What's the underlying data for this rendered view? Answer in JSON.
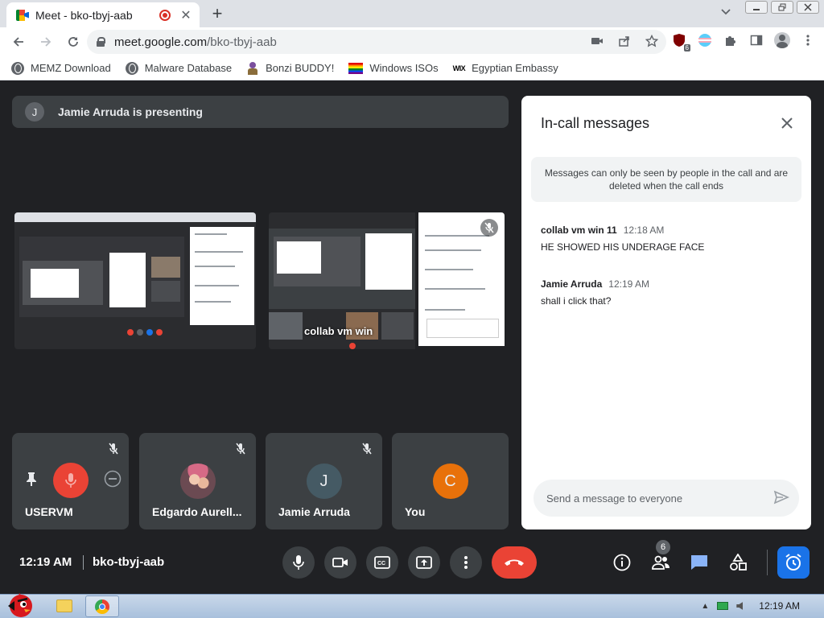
{
  "browser": {
    "tab_title": "Meet - bko-tbyj-aab",
    "tab_close": "✕",
    "new_tab": "+",
    "url_domain": "meet.google.com",
    "url_path": "/bko-tbyj-aab",
    "extension_badge": "6",
    "bookmarks": [
      {
        "label": "MEMZ Download",
        "icon": "globe-icon"
      },
      {
        "label": "Malware Database",
        "icon": "globe-icon"
      },
      {
        "label": "Bonzi BUDDY!",
        "icon": "bonzi-icon"
      },
      {
        "label": "Windows ISOs",
        "icon": "rainbow-flag-icon"
      },
      {
        "label": "Egyptian Embassy",
        "icon": "wix-icon",
        "icon_text": "WIX"
      }
    ]
  },
  "meet": {
    "presenter_initial": "J",
    "presenting_text": "Jamie Arruda is presenting",
    "share_caption": "collab vm win",
    "tiles": [
      {
        "name": "USERVM",
        "muted": true,
        "avatar": "hover-controls"
      },
      {
        "name": "Edgardo Aurell...",
        "muted": true,
        "avatar": "photo"
      },
      {
        "name": "Jamie Arruda",
        "muted": true,
        "avatar": "J",
        "avatar_color": "#455a64"
      },
      {
        "name": "You",
        "muted": false,
        "avatar": "C",
        "avatar_color": "#e8710a"
      }
    ],
    "chat": {
      "title": "In-call messages",
      "notice": "Messages can only be seen by people in the call and are deleted when the call ends",
      "messages": [
        {
          "sender": "collab vm win 11",
          "time": "12:18 AM",
          "text": "HE SHOWED HIS UNDERAGE FACE"
        },
        {
          "sender": "Jamie Arruda",
          "time": "12:19 AM",
          "text": "shall i click  that?"
        }
      ],
      "input_placeholder": "Send a message to everyone"
    },
    "bottom": {
      "time": "12:19 AM",
      "meeting_code": "bko-tbyj-aab",
      "people_count": "6"
    },
    "colors": {
      "end_call": "#ea4335",
      "accent": "#1a73e8",
      "tile_bg": "#3c4043"
    }
  },
  "taskbar": {
    "clock": "12:19 AM"
  }
}
